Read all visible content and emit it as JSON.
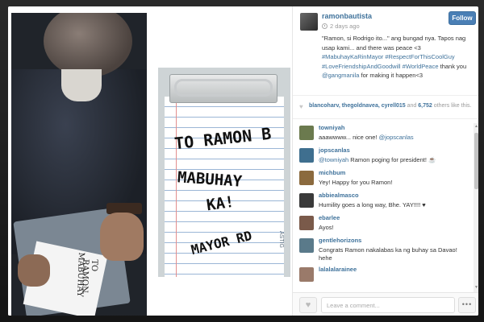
{
  "post": {
    "username": "ramonbautista",
    "time_ago": "2 days ago",
    "follow_label": "Follow",
    "caption_parts": [
      "\"Ramon, si Rodrigo ito...\" ang bungad nya. Tapos nag usap kami... and there was peace <3 ",
      "#MabuhayKaRinMayor #RespectForThisCoolGuy #LoveFriendshipAndGoodwill #WorldPeace",
      " thank you ",
      "@gangmanila",
      " for making it happen<3"
    ]
  },
  "likes": {
    "users": "blancoharv, thegoldnavea, cyrell015",
    "and_text": " and ",
    "count": "6,752",
    "suffix": " others like this."
  },
  "comments": [
    {
      "user": "towniyah",
      "text": "aaawwww... nice one! ",
      "mention": "@jopscanlas",
      "after": "",
      "avatar": "#6b7a4e"
    },
    {
      "user": "jopscanlas",
      "text": "",
      "mention": "@towniyah",
      "after": " Ramon poging for president! ☕",
      "avatar": "#3f6f8f"
    },
    {
      "user": "michbum",
      "text": "Yey! Happy for you Ramon!",
      "mention": "",
      "after": "",
      "avatar": "#8b6a3e"
    },
    {
      "user": "abbiealmasco",
      "text": "Humility goes a long way, Bhe. YAY!!!! ♥",
      "mention": "",
      "after": "",
      "avatar": "#3a3a3a"
    },
    {
      "user": "ebarlee",
      "text": "Ayos!",
      "mention": "",
      "after": "",
      "avatar": "#7a5a4a"
    },
    {
      "user": "gentlehorizons",
      "text": "Congrats Ramon nakalabas ka ng buhay sa Davao!",
      "line2": "hehe",
      "mention": "",
      "after": "",
      "avatar": "#5a7a8a"
    },
    {
      "user": "lalalalarainee",
      "text": "",
      "mention": "",
      "after": "",
      "avatar": "#9a7a6a"
    }
  ],
  "footer": {
    "comment_placeholder": "Leave a comment...",
    "more_label": "•••"
  },
  "photo": {
    "note_lines": [
      "TO RAMON B",
      "MABUHAY",
      "KA!",
      "MAYOR RD"
    ],
    "note_flag": "ASTIG",
    "small_paper_lines": [
      "TO RAMON",
      "MABUHAY"
    ]
  },
  "colors": {
    "accent": "#3f729b",
    "follow_bg": "#4a7fb5"
  }
}
